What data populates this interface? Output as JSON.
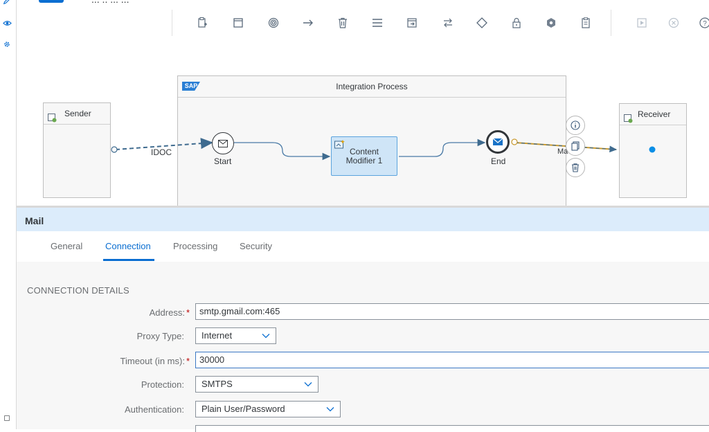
{
  "title": {
    "text": "... .. ... ..."
  },
  "canvas": {
    "process_title": "Integration Process",
    "sap_logo": "SAP",
    "sender": "Sender",
    "receiver": "Receiver",
    "idoc_label": "IDOC",
    "mail_label": "Ma",
    "start_label": "Start",
    "end_label": "End",
    "content_modifier": {
      "line1": "Content",
      "line2": "Modifier 1"
    }
  },
  "panel": {
    "title": "Mail",
    "tabs": [
      "General",
      "Connection",
      "Processing",
      "Security"
    ],
    "active_tab": "Connection",
    "section_title": "CONNECTION DETAILS",
    "fields": {
      "address": {
        "label": "Address:",
        "value": "smtp.gmail.com:465",
        "required": true
      },
      "proxy_type": {
        "label": "Proxy Type:",
        "value": "Internet"
      },
      "timeout": {
        "label": "Timeout (in ms):",
        "value": "30000",
        "required": true
      },
      "protection": {
        "label": "Protection:",
        "value": "SMTPS"
      },
      "authentication": {
        "label": "Authentication:",
        "value": "Plain User/Password"
      }
    },
    "required_mark": "*"
  },
  "colors": {
    "accent": "#0a6ed1",
    "header_bg": "#dcecfb",
    "mail_flow": "#c99a2e",
    "idoc_flow": "#3f6b8f"
  }
}
